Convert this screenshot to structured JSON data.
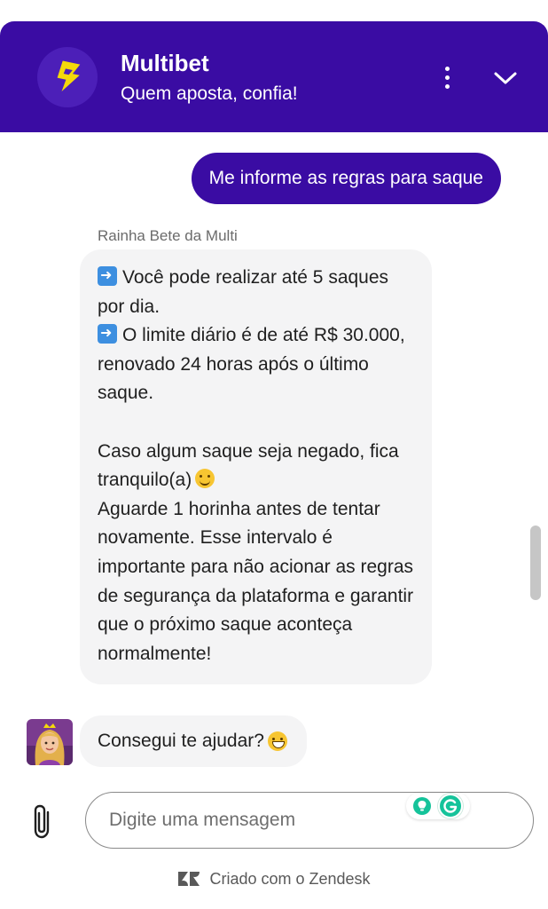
{
  "header": {
    "title": "Multibet",
    "tagline": "Quem aposta, confia!",
    "bg_color": "#3a0ca3",
    "logo_color": "#f5d90a"
  },
  "conversation": {
    "user_message": "Me informe as regras para saque",
    "agent_name": "Rainha Bete da Multi",
    "bot_message": {
      "line1": "Você pode realizar até 5 saques por dia.",
      "line2": "O limite diário é de até R$ 30.000, renovado 24 horas após o último saque.",
      "line3": "Caso algum saque seja negado, fica tranquilo(a)",
      "line4": "Aguarde 1 horinha antes de tentar novamente. Esse intervalo é importante para não acionar as regras de segurança da plataforma e garantir que o próximo saque aconteça normalmente!"
    },
    "bot_followup": "Consegui te ajudar?"
  },
  "composer": {
    "placeholder": "Digite uma mensagem"
  },
  "footer": {
    "text": "Criado com o Zendesk"
  }
}
